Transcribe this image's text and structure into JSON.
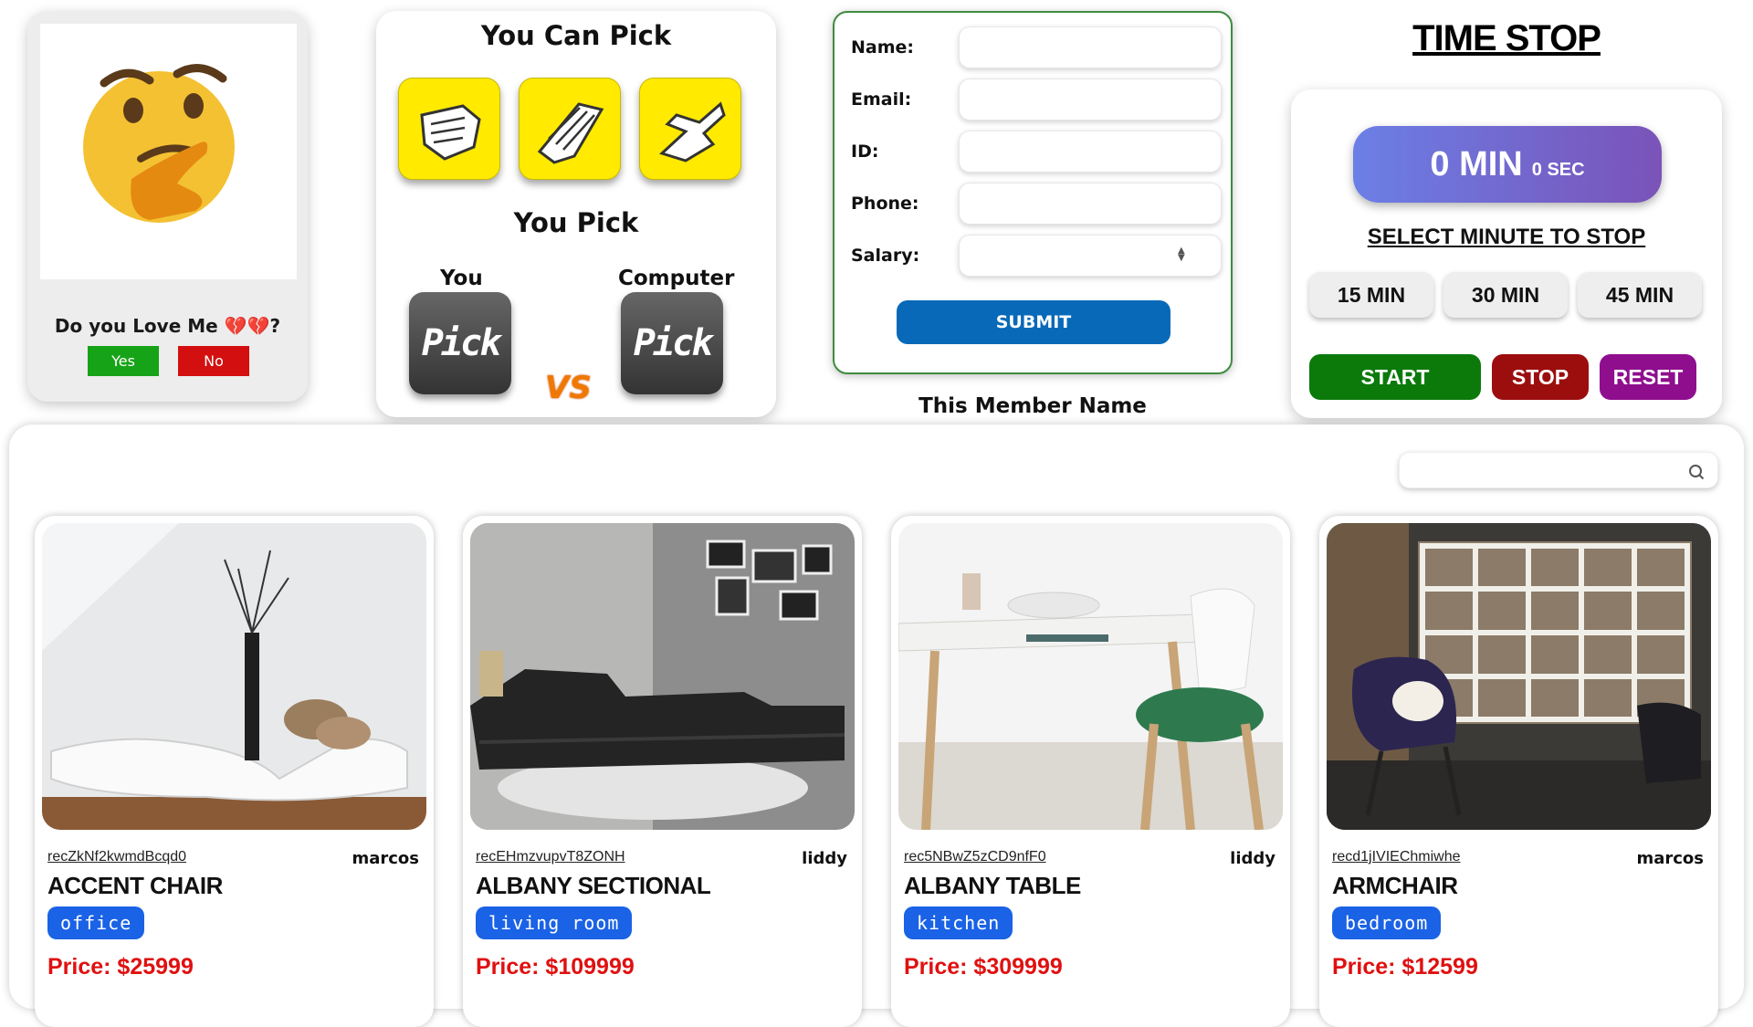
{
  "love_card": {
    "question": "Do you Love Me 💔💔?",
    "yes_label": "Yes",
    "no_label": "No"
  },
  "rps": {
    "title": "You Can Pick",
    "options": [
      "fist-rock",
      "hand-paper",
      "hand-scissors"
    ],
    "subtitle": "You Pick",
    "you_label": "You",
    "computer_label": "Computer",
    "you_pick_text": "Pick",
    "computer_pick_text": "Pick",
    "vs_text": "VS"
  },
  "member_form": {
    "fields": [
      {
        "label": "Name:",
        "value": ""
      },
      {
        "label": "Email:",
        "value": ""
      },
      {
        "label": "ID:",
        "value": ""
      },
      {
        "label": "Phone:",
        "value": ""
      },
      {
        "label": "Salary:",
        "value": ""
      }
    ],
    "submit_label": "SUBMIT",
    "member_name": "This Member Name"
  },
  "timer": {
    "title": "TIME STOP",
    "minutes_text": "0 MIN",
    "seconds_text": "0 SEC",
    "select_label": "SELECT MINUTE TO STOP",
    "minute_options": [
      "15 MIN",
      "30 MIN",
      "45 MIN"
    ],
    "start_label": "START",
    "stop_label": "STOP",
    "reset_label": "RESET",
    "colors": {
      "start": "#0b7a0b",
      "stop": "#9c0e0e",
      "reset": "#8e0e8e"
    }
  },
  "search": {
    "placeholder": "",
    "icon": "search-icon"
  },
  "products": [
    {
      "id": "recZkNf2kwmdBcqd0",
      "owner": "marcos",
      "name": "ACCENT CHAIR",
      "category": "office",
      "price": "Price: $25999"
    },
    {
      "id": "recEHmzvupvT8ZONH",
      "owner": "liddy",
      "name": "ALBANY SECTIONAL",
      "category": "living room",
      "price": "Price: $109999"
    },
    {
      "id": "rec5NBwZ5zCD9nfF0",
      "owner": "liddy",
      "name": "ALBANY TABLE",
      "category": "kitchen",
      "price": "Price: $309999"
    },
    {
      "id": "recd1jIVIEChmiwhe",
      "owner": "marcos",
      "name": "ARMCHAIR",
      "category": "bedroom",
      "price": "Price: $12599"
    }
  ]
}
